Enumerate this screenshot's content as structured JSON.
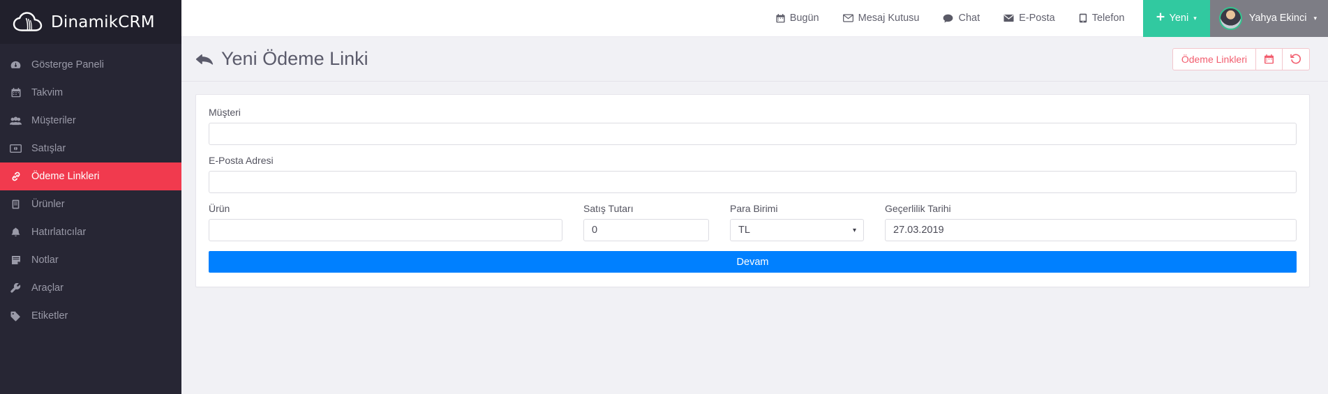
{
  "brand": {
    "name": "DinamikCRM",
    "logo_icon": "cloud-icon"
  },
  "sidebar": {
    "items": [
      {
        "label": "Gösterge Paneli",
        "icon": "dashboard-icon",
        "glyph": "◉",
        "active": false
      },
      {
        "label": "Takvim",
        "icon": "calendar-icon",
        "glyph": "▦",
        "active": false
      },
      {
        "label": "Müşteriler",
        "icon": "users-icon",
        "glyph": "👥",
        "active": false
      },
      {
        "label": "Satışlar",
        "icon": "money-bill-icon",
        "glyph": "▭",
        "active": false
      },
      {
        "label": "Ödeme Linkleri",
        "icon": "link-icon",
        "glyph": "🔗",
        "active": true
      },
      {
        "label": "Ürünler",
        "icon": "box-icon",
        "glyph": "▤",
        "active": false
      },
      {
        "label": "Hatırlatıcılar",
        "icon": "bell-icon",
        "glyph": "🔔",
        "active": false
      },
      {
        "label": "Notlar",
        "icon": "note-icon",
        "glyph": "🗒",
        "active": false
      },
      {
        "label": "Araçlar",
        "icon": "wrench-icon",
        "glyph": "🔧",
        "active": false
      },
      {
        "label": "Etiketler",
        "icon": "tag-icon",
        "glyph": "🏷",
        "active": false
      }
    ]
  },
  "topbar": {
    "nav": [
      {
        "label": "Bugün",
        "icon": "calendar-icon",
        "glyph": "▦"
      },
      {
        "label": "Mesaj Kutusu",
        "icon": "envelope-open-icon",
        "glyph": "✉"
      },
      {
        "label": "Chat",
        "icon": "comment-icon",
        "glyph": "💬"
      },
      {
        "label": "E-Posta",
        "icon": "envelope-icon",
        "glyph": "✉"
      },
      {
        "label": "Telefon",
        "icon": "phone-icon",
        "glyph": "📞"
      }
    ],
    "new_button": {
      "label": "Yeni",
      "icon": "plus-icon",
      "glyph": "✚",
      "caret": "▾",
      "color": "#31c9a0"
    },
    "user": {
      "name": "Yahya Ekinci",
      "caret": "▾",
      "avatar_icon": "user-avatar"
    }
  },
  "page": {
    "title": "Yeni Ödeme Linki",
    "back_icon": "back-arrow-icon",
    "back_glyph": "↩",
    "actions": [
      {
        "label": "Ödeme Linkleri",
        "icon": "",
        "type": "text"
      },
      {
        "label": "▦",
        "icon": "calendar-icon",
        "type": "icon"
      },
      {
        "label": "↺",
        "icon": "history-undo-icon",
        "type": "icon"
      }
    ],
    "action_color": "#f25d6e"
  },
  "form": {
    "customer": {
      "label": "Müşteri",
      "value": "",
      "placeholder": ""
    },
    "email": {
      "label": "E-Posta Adresi",
      "value": "",
      "placeholder": ""
    },
    "product": {
      "label": "Ürün",
      "value": "",
      "placeholder": ""
    },
    "amount": {
      "label": "Satış Tutarı",
      "value": "0",
      "placeholder": ""
    },
    "currency": {
      "label": "Para Birimi",
      "value": "TL",
      "caret": "▾",
      "options": [
        "TL"
      ]
    },
    "expiry": {
      "label": "Geçerlilik Tarihi",
      "value": "27.03.2019",
      "placeholder": ""
    },
    "submit": {
      "label": "Devam",
      "color": "#0080ff"
    }
  }
}
